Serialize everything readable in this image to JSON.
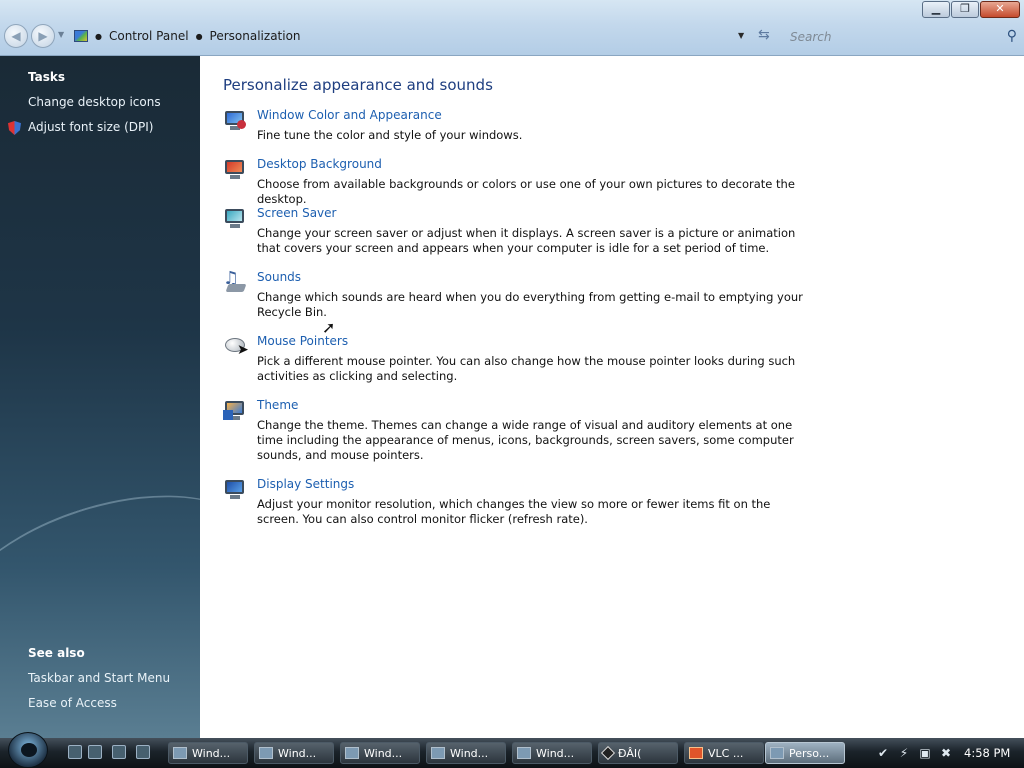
{
  "window": {
    "minimize": "▁",
    "maximize": "❐",
    "close": "✕"
  },
  "address": {
    "crumbs": [
      "Control Panel",
      "Personalization"
    ]
  },
  "search": {
    "placeholder": "Search"
  },
  "sidebar": {
    "tasks_heading": "Tasks",
    "tasks": [
      {
        "label": "Change desktop icons",
        "icon": "none"
      },
      {
        "label": "Adjust font size (DPI)",
        "icon": "shield-icon"
      }
    ],
    "see_also_heading": "See also",
    "see_also": [
      {
        "label": "Taskbar and Start Menu"
      },
      {
        "label": "Ease of Access"
      }
    ]
  },
  "main": {
    "title": "Personalize appearance and sounds",
    "items": [
      {
        "label": "Window Color and Appearance",
        "icon": "window-color-icon",
        "description": "Fine tune the color and style of your windows."
      },
      {
        "label": "Desktop Background",
        "icon": "desktop-background-icon",
        "description": "Choose from available backgrounds or colors or use one of your own pictures to decorate the desktop."
      },
      {
        "label": "Screen Saver",
        "icon": "screen-saver-icon",
        "description": "Change your screen saver or adjust when it displays. A screen saver is a picture or animation that covers your screen and appears when your computer is idle for a set period of time."
      },
      {
        "label": "Sounds",
        "icon": "sounds-icon",
        "description": "Change which sounds are heard when you do everything from getting e-mail to emptying your Recycle Bin."
      },
      {
        "label": "Mouse Pointers",
        "icon": "mouse-pointers-icon",
        "description": "Pick a different mouse pointer. You can also change how the mouse pointer looks during such activities as clicking and selecting."
      },
      {
        "label": "Theme",
        "icon": "theme-icon",
        "description": "Change the theme. Themes can change a wide range of visual and auditory elements at one time including the appearance of menus, icons, backgrounds, screen savers, some computer sounds, and mouse pointers."
      },
      {
        "label": "Display Settings",
        "icon": "display-settings-icon",
        "description": "Adjust your monitor resolution, which changes the view so more or fewer items fit on the screen. You can also control monitor flicker (refresh rate)."
      }
    ]
  },
  "taskbar": {
    "buttons": [
      {
        "label": "Wind...",
        "active": false
      },
      {
        "label": "Wind...",
        "active": false
      },
      {
        "label": "Wind...",
        "active": false
      },
      {
        "label": "Wind...",
        "active": false
      },
      {
        "label": "Wind...",
        "active": false
      },
      {
        "label": "ĐÂI(",
        "active": false
      },
      {
        "label": "VLC ...",
        "active": false
      },
      {
        "label": "Perso...",
        "active": true
      }
    ],
    "clock": "4:58 PM"
  },
  "colors": {
    "link": "#1d5fb0",
    "title": "#1e3e80",
    "sidebar_bg": "#1e3547"
  }
}
